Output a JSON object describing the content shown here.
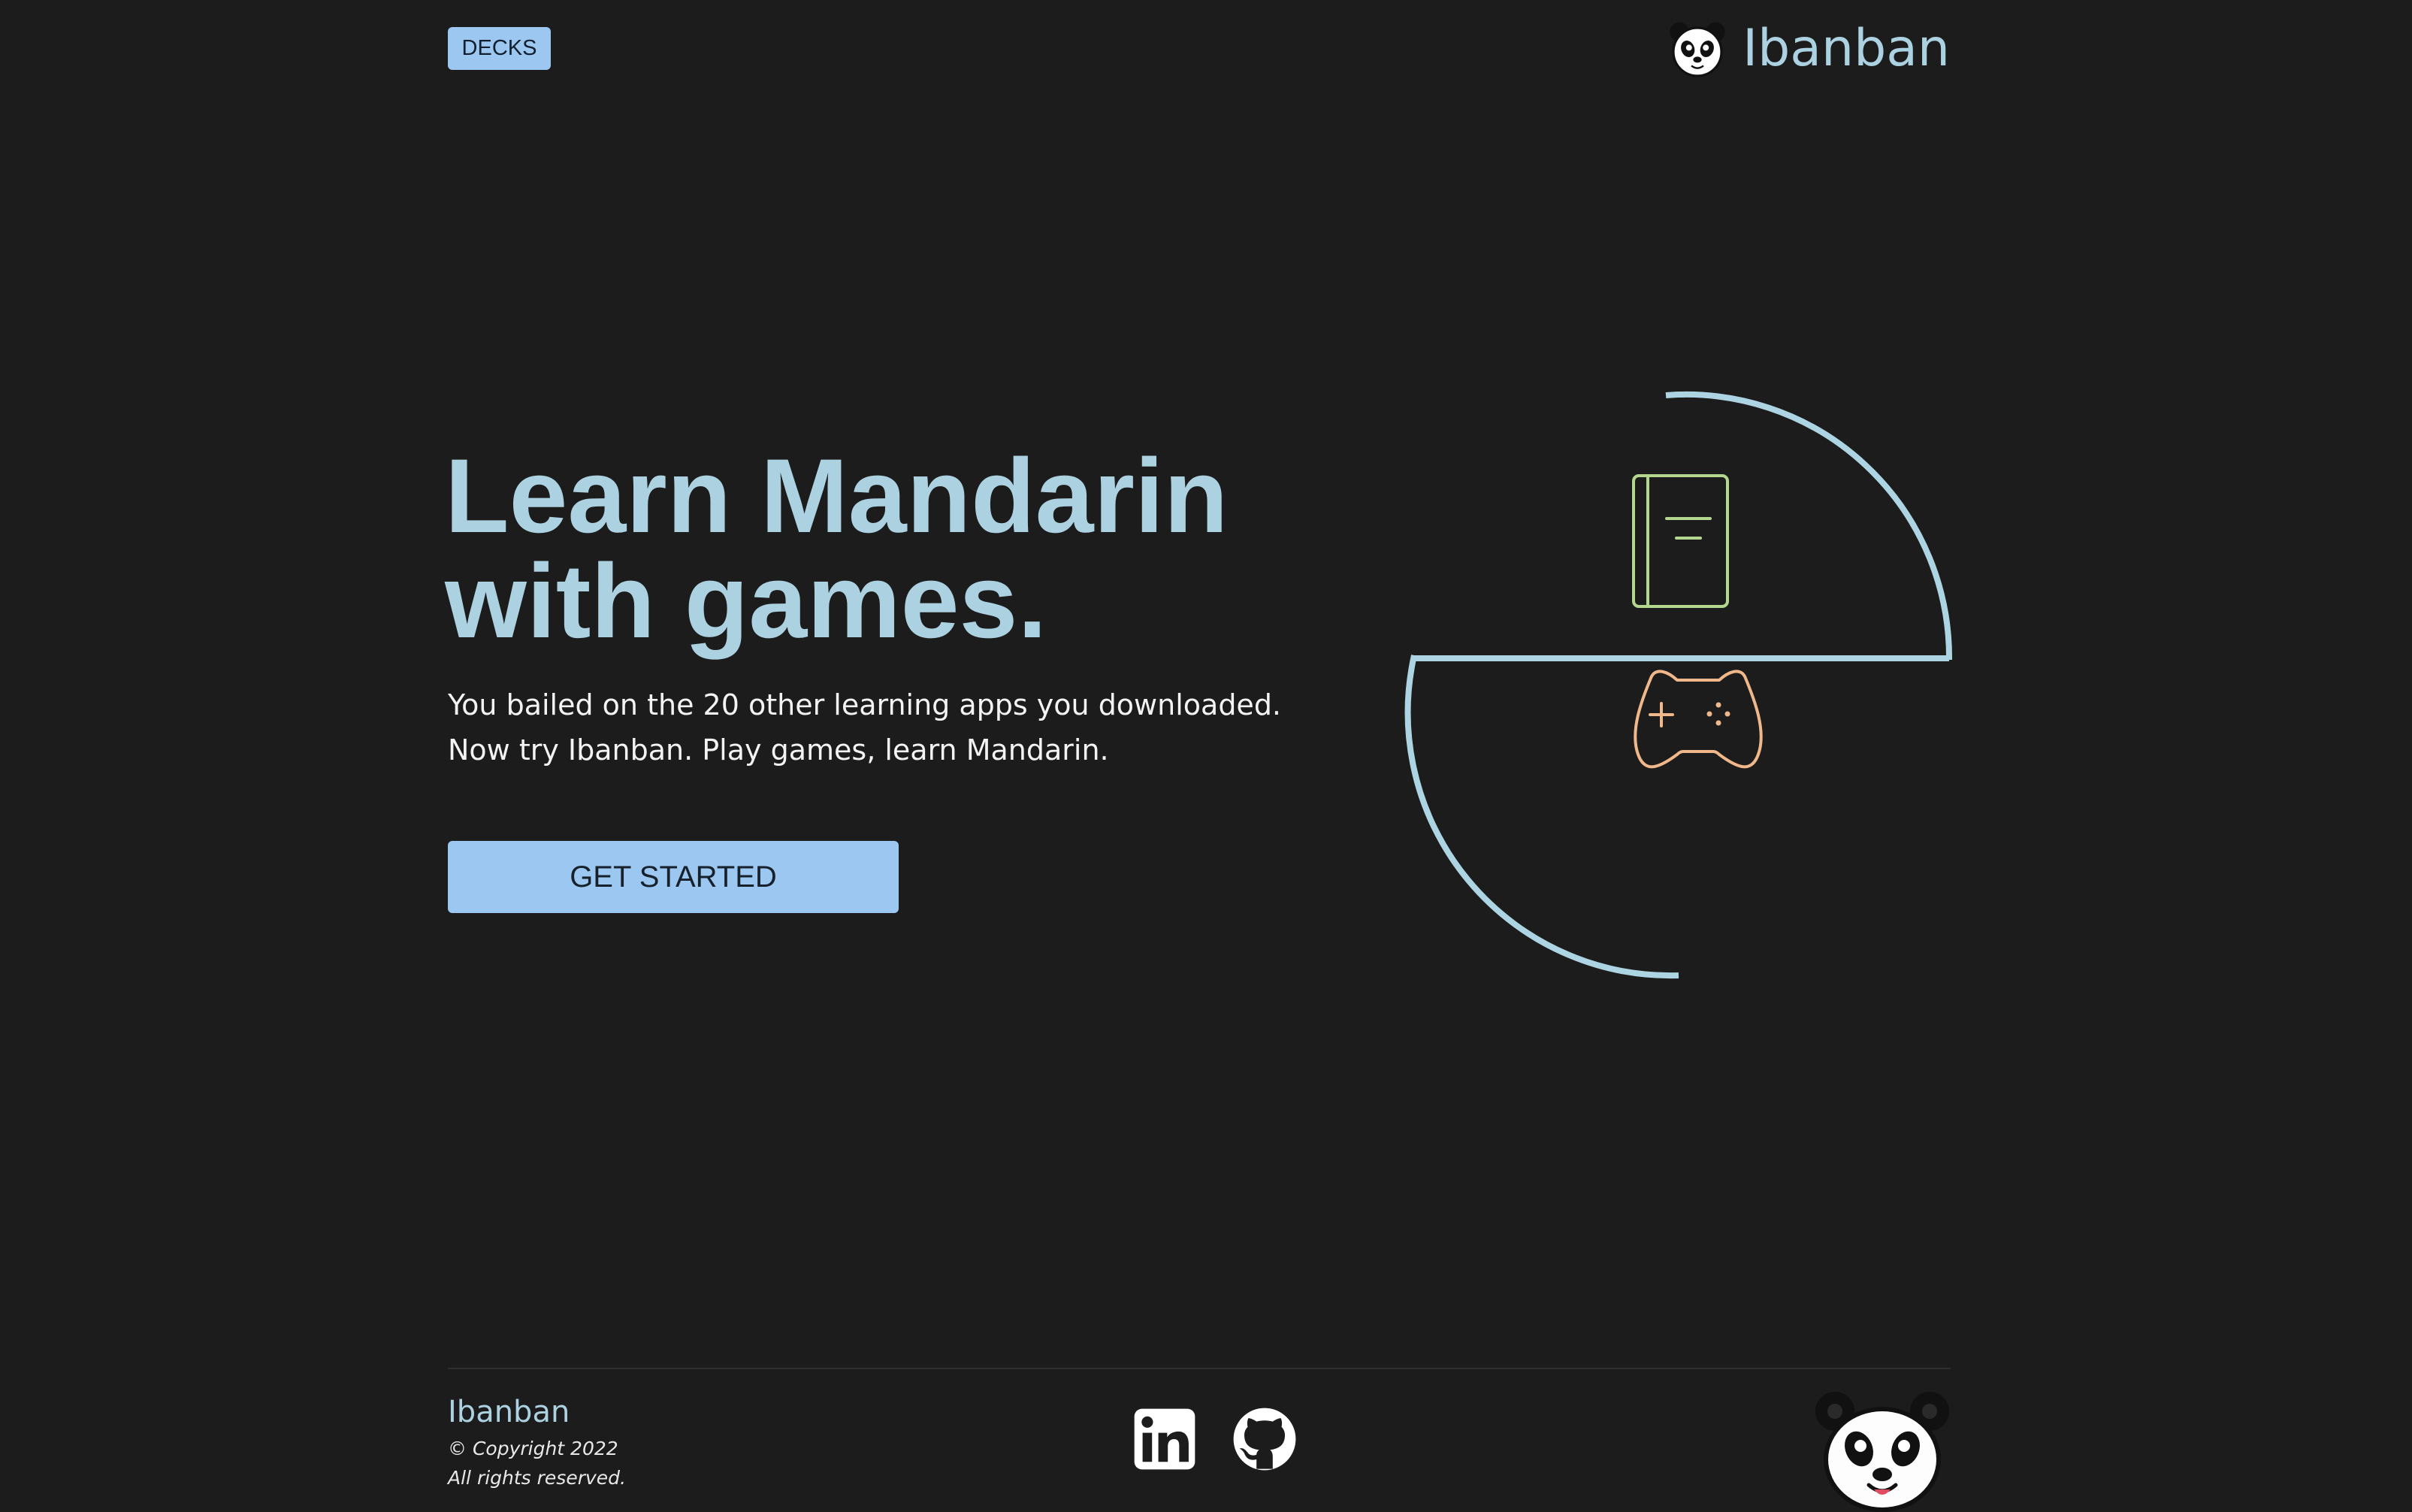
{
  "header": {
    "decks_label": "DECKS",
    "brand_name": "Ibanban",
    "logo_icon": "panda-logo-icon"
  },
  "hero": {
    "title_line1": "Learn Mandarin",
    "title_line2": "with games.",
    "subtitle_line1": "You bailed on the 20 other learning apps you downloaded.",
    "subtitle_line2": "Now try Ibanban. Play games, learn Mandarin.",
    "cta_label": "GET STARTED"
  },
  "illustration": {
    "top_icon": "book-icon",
    "bottom_icon": "game-controller-icon"
  },
  "footer": {
    "brand": "Ibanban",
    "copyright": "© Copyright 2022",
    "rights": "All rights reserved.",
    "social_icons": [
      "linkedin-icon",
      "github-icon"
    ],
    "mascot_icon": "panda-mascot-icon"
  },
  "colors": {
    "background": "#1c1c1c",
    "accent_blue": "#9cc7f1",
    "title_blue": "#acd1e1",
    "book_green": "#b4d790",
    "controller_orange": "#f0b88a",
    "text_white": "#f3f3f3"
  }
}
